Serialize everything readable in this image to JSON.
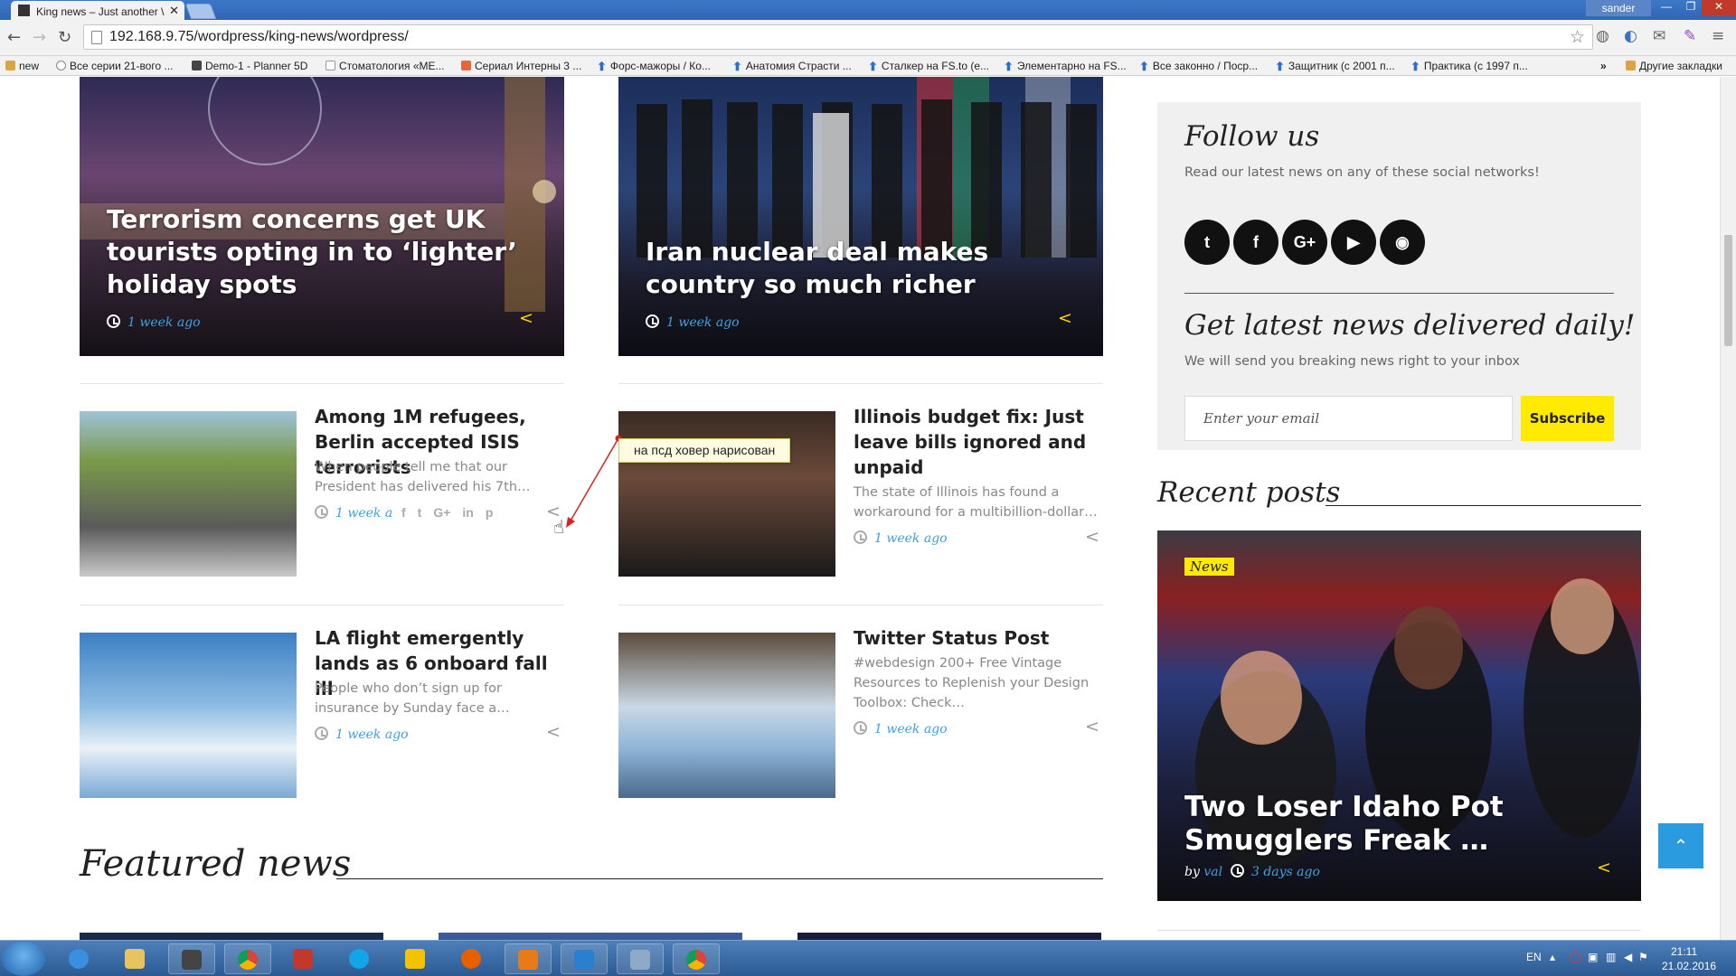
{
  "browser": {
    "tab_title": "King news – Just another \\",
    "user": "sander",
    "url": "192.168.9.75/wordpress/king-news/wordpress/",
    "bookmarks": [
      "new",
      "Все серии 21-вого ...",
      "Demo-1 - Planner 5D",
      "Стоматология «МЕ...",
      "Сериал Интерны 3 ...",
      "Форс-мажоры / Ко...",
      "Анатомия Страсти ...",
      "Сталкер на FS.to (е...",
      "Элементарно на FS...",
      "Все законно / Поср...",
      "Защитник (с 2001 п...",
      "Практика (с 1997 п..."
    ],
    "bookmarks_other": "Другие закладки",
    "chevrons": "»"
  },
  "hero": [
    {
      "title": "Terrorism concerns get UK tourists opting in to ‘lighter’ holiday spots",
      "date": "1 week ago"
    },
    {
      "title": "Iran nuclear deal makes country so much richer",
      "date": "1 week ago"
    }
  ],
  "articles": [
    {
      "title": "Among 1M refugees, Berlin accepted ISIS terrorists",
      "excerpt": "When people tell me that our President has delivered his 7th…",
      "date": "1 week a"
    },
    {
      "title": "Illinois budget fix: Just leave bills ignored and unpaid",
      "excerpt": "The state of Illinois has found a workaround for a multibillion-dollar…",
      "date": "1 week ago"
    },
    {
      "title": "LA flight emergently lands as 6 onboard fall ill",
      "excerpt": "People who don’t sign up for insurance by Sunday face a…",
      "date": "1 week ago"
    },
    {
      "title": "Twitter Status Post",
      "excerpt": "#webdesign 200+ Free Vintage Resources to Replenish your Design Toolbox: Check…",
      "date": "1 week ago"
    }
  ],
  "social_icons": [
    "f",
    "t",
    "G+",
    "in",
    "p"
  ],
  "annotation": "на псд ховер нарисован",
  "featured_title": "Featured news",
  "sidebar": {
    "follow_title": "Follow us",
    "follow_text": "Read our latest news on any of these social networks!",
    "social": [
      "t",
      "f",
      "G+",
      "▶",
      "◉"
    ],
    "newsletter_title": "Get latest news delivered daily!",
    "newsletter_text": "We will send you breaking news right to your inbox",
    "email_placeholder": "Enter your email",
    "subscribe": "Subscribe",
    "recent_title": "Recent posts",
    "recent": {
      "badge": "News",
      "title": "Two Loser Idaho Pot Smugglers Freak …",
      "by": "by",
      "author": "val",
      "date": "3 days ago"
    }
  },
  "taskbar": {
    "lang": "EN",
    "time": "21:11",
    "date": "21.02.2016"
  },
  "colors": {
    "accent_blue": "#3aa3e3",
    "accent_yellow": "#ffea00",
    "totop": "#2b9be0"
  }
}
